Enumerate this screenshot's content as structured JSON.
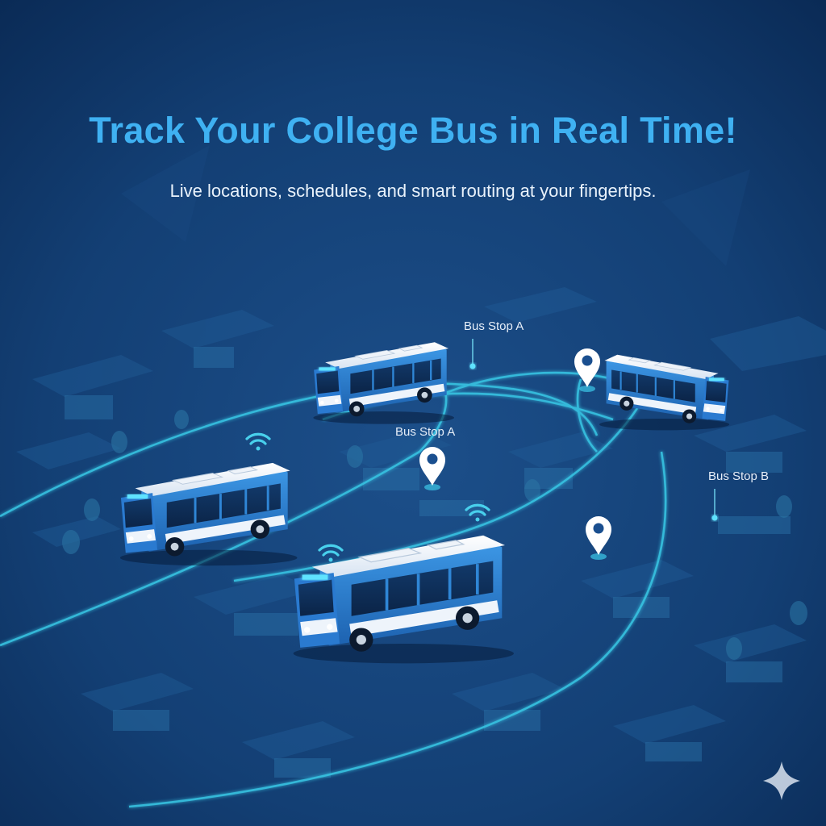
{
  "headline": "Track Your College Bus in Real Time!",
  "subheadline": "Live locations, schedules, and smart routing at your fingertips.",
  "stop_labels": [
    "Bus Stop A",
    "Bus Stop A",
    "Bus Stop B"
  ],
  "colors": {
    "background": "#0d3466",
    "headline": "#3fb1f2",
    "route_line": "#38c6e4",
    "bus_body": "#2f86d6",
    "bus_roof": "#f2f6fb",
    "pin": "#ffffff"
  },
  "icons": [
    "map-pin-icon",
    "wifi-signal-icon",
    "bus-icon",
    "sparkle-icon"
  ]
}
